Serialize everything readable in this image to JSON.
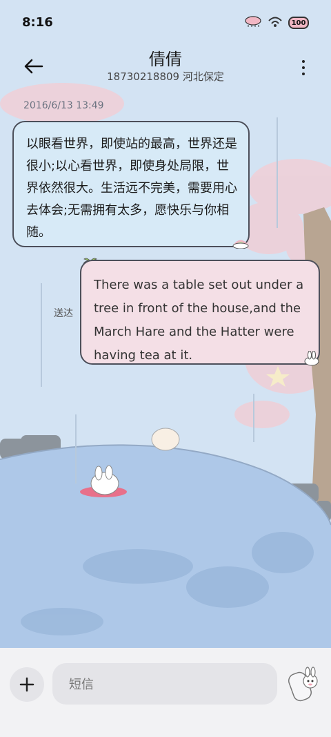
{
  "status_bar": {
    "time": "8:16",
    "battery": "100"
  },
  "header": {
    "contact_name": "倩倩",
    "contact_info": "18730218809 河北保定"
  },
  "conversation": {
    "timestamp": "2016/6/13 13:49",
    "incoming_message": "以眼看世界，即使站的最高，世界还是很小;以心看世界，即使身处局限，世界依然很大。生活远不完美，需要用心去体会;无需拥有太多，愿快乐与你相随。",
    "outgoing_message": "There was a table set out under a tree in front of the house,and the March Hare and the Hatter were having tea at it.",
    "delivery_status": "送达"
  },
  "composer": {
    "placeholder": "短信"
  },
  "icons": {
    "back": "back-arrow-icon",
    "more": "more-vertical-icon",
    "add": "plus-icon",
    "send": "bunny-send-sticker-icon"
  },
  "colors": {
    "incoming_bubble": "#d7eaf7",
    "outgoing_bubble": "#f4dfe6",
    "bubble_border": "#4c4f5a",
    "water": "#aec8e8"
  }
}
